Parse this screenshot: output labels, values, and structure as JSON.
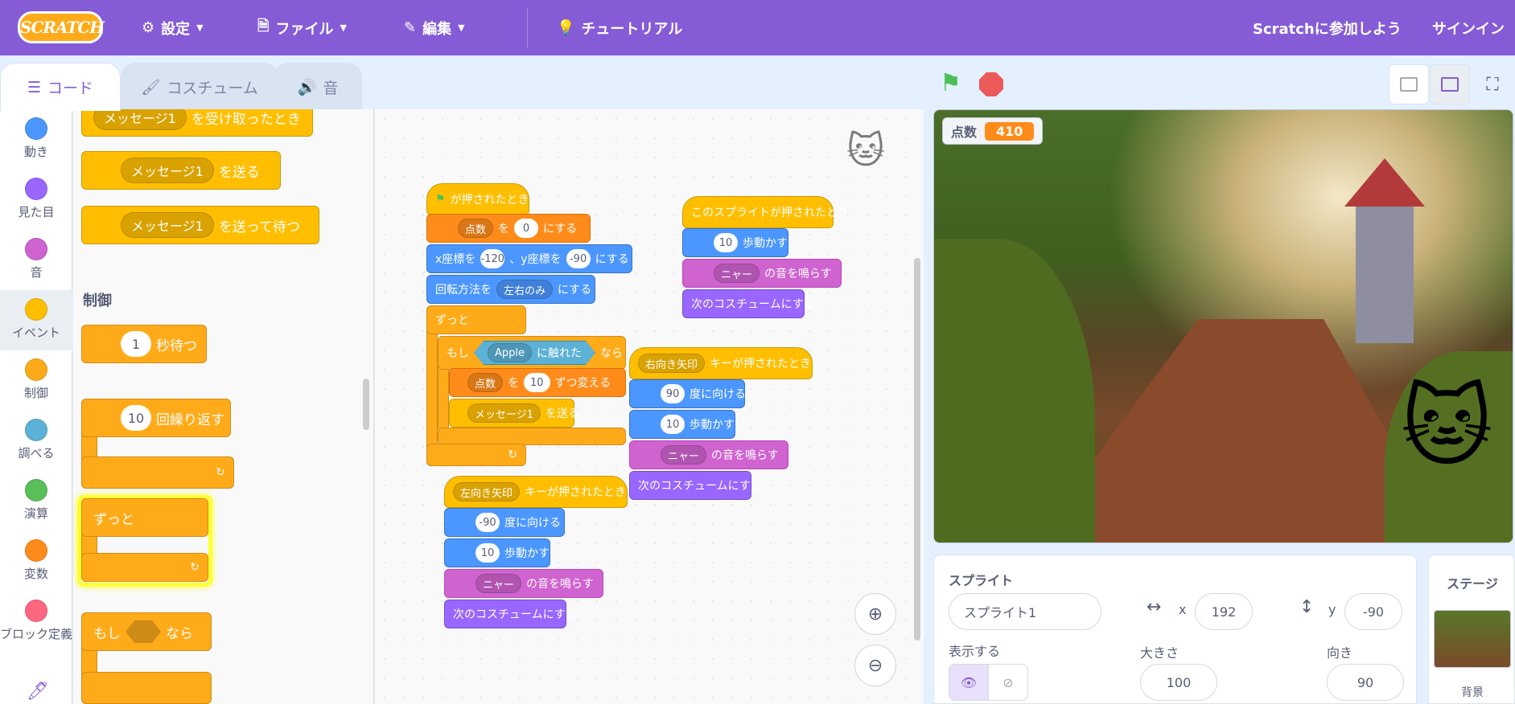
{
  "topbar": {
    "logo": "SCRATCH",
    "settings": "設定",
    "file": "ファイル",
    "edit": "編集",
    "tutorials": "チュートリアル",
    "join": "Scratchに参加しよう",
    "signin": "サインイン"
  },
  "tabs": {
    "code": "コード",
    "costumes": "コスチューム",
    "sounds": "音"
  },
  "categories": [
    {
      "label": "動き",
      "color": "#4c97ff"
    },
    {
      "label": "見た目",
      "color": "#9966ff"
    },
    {
      "label": "音",
      "color": "#cf63cf"
    },
    {
      "label": "イベント",
      "color": "#ffbf00"
    },
    {
      "label": "制御",
      "color": "#ffab19"
    },
    {
      "label": "調べる",
      "color": "#5cb1d6"
    },
    {
      "label": "演算",
      "color": "#59c059"
    },
    {
      "label": "変数",
      "color": "#ff8c1a"
    },
    {
      "label": "ブロック定義",
      "color": "#ff6680"
    }
  ],
  "palette": {
    "msg": "メッセージ1",
    "when_receive": "を受け取ったとき",
    "broadcast": "を送る",
    "broadcast_wait": "を送って待つ",
    "control_heading": "制御",
    "wait_num": "1",
    "wait_text": "秒待つ",
    "repeat_num": "10",
    "repeat_text": "回繰り返す",
    "forever": "ずっと",
    "if": "もし",
    "then": "なら"
  },
  "script1": {
    "flag_clicked": "が押されたとき",
    "var_score": "点数",
    "set_to": "を",
    "set_val": "0",
    "set_end": "にする",
    "goto_x_lbl": "x座標を",
    "goto_x": "-120",
    "goto_y_lbl": "、y座標を",
    "goto_y": "-90",
    "goto_end": "にする",
    "rot_lbl": "回転方法を",
    "rot_val": "左右のみ",
    "rot_end": "にする",
    "forever": "ずっと",
    "if": "もし",
    "touch_obj": "Apple",
    "touching": "に触れた",
    "then": "なら",
    "change_var": "点数",
    "change_by": "を",
    "change_val": "10",
    "change_end": "ずつ変える",
    "bcast_msg": "メッセージ1",
    "bcast_end": "を送る"
  },
  "script2": {
    "hat": "このスプライトが押されたとき",
    "move_val": "10",
    "move_text": "歩動かす",
    "sound": "ニャー",
    "sound_text": "の音を鳴らす",
    "next_costume": "次のコスチュームにする"
  },
  "script3": {
    "key": "右向き矢印",
    "key_text": "キーが押されたとき",
    "dir_val": "90",
    "dir_text": "度に向ける",
    "move_val": "10",
    "move_text": "歩動かす",
    "sound": "ニャー",
    "sound_text": "の音を鳴らす",
    "next_costume": "次のコスチュームにする"
  },
  "script4": {
    "key": "左向き矢印",
    "key_text": "キーが押されたとき",
    "dir_val": "-90",
    "dir_text": "度に向ける",
    "move_val": "10",
    "move_text": "歩動かす",
    "sound": "ニャー",
    "sound_text": "の音を鳴らす",
    "next_costume": "次のコスチュームにする"
  },
  "stage": {
    "monitor_label": "点数",
    "monitor_value": "410"
  },
  "sprite_info": {
    "sprite_label": "スプライト",
    "sprite_name": "スプライト1",
    "x_label": "x",
    "x_val": "192",
    "y_label": "y",
    "y_val": "-90",
    "show_label": "表示する",
    "size_label": "大きさ",
    "size_val": "100",
    "dir_label": "向き",
    "dir_val": "90"
  },
  "stage_pane": {
    "title": "ステージ",
    "backdrop_label": "背景"
  }
}
